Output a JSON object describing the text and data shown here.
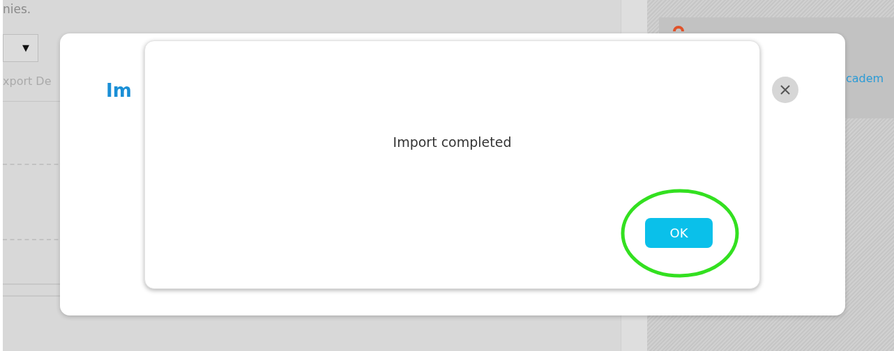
{
  "background": {
    "description_fragment": "nies.",
    "dropdown": {
      "arrow": "▼"
    },
    "label_fragment": "xport De",
    "card_link_fragment": "cadem"
  },
  "modal": {
    "title_fragment": "Im"
  },
  "dialog": {
    "message": "Import completed",
    "buttons": [
      {
        "label": "OK",
        "highlighted": true
      }
    ]
  }
}
